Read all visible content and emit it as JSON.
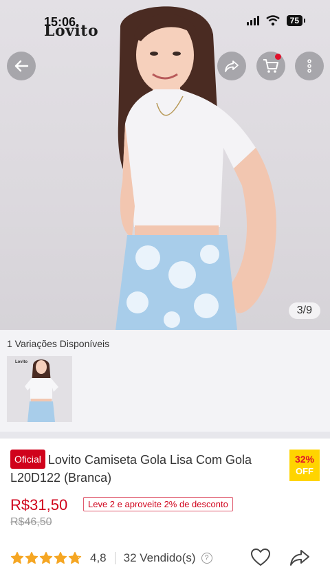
{
  "status_bar": {
    "time": "15:06",
    "battery": "75"
  },
  "brand": {
    "logo_text": "Lovito"
  },
  "gallery": {
    "page_indicator": "3/9"
  },
  "variations": {
    "title": "1 Variações Disponíveis",
    "thumb_logo": "Lovito"
  },
  "product": {
    "badge": "Oficial",
    "title": "Lovito Camiseta Gola Lisa Com Gola L20D122 (Branca)",
    "discount_percent": "32%",
    "discount_label": "OFF",
    "price": "R$31,50",
    "promo": "Leve 2 e aproveite 2% de desconto",
    "old_price": "R$46,50",
    "rating": "4,8",
    "rating_value": 4.8,
    "sold": "32 Vendido(s)"
  },
  "colors": {
    "accent": "#d0021b",
    "discount_bg": "#ffd400",
    "star": "#f5a623"
  },
  "icons": [
    "back-arrow-icon",
    "share-icon",
    "cart-icon",
    "more-icon",
    "heart-icon",
    "help-icon"
  ]
}
